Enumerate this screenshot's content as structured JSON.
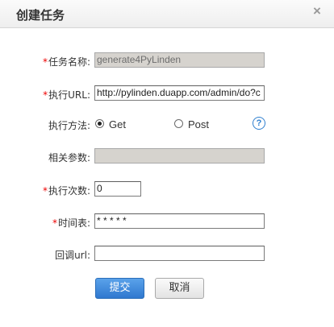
{
  "dialog": {
    "title": "创建任务",
    "close_glyph": "×"
  },
  "form": {
    "required_mark": "*",
    "task_name": {
      "label": "任务名称:",
      "value": "generate4PyLinden",
      "required": true
    },
    "exec_url": {
      "label": "执行URL:",
      "value": "http://pylinden.duapp.com/admin/do?c",
      "required": true
    },
    "method": {
      "label": "执行方法:",
      "options": [
        "Get",
        "Post"
      ],
      "selected": "Get",
      "help_glyph": "?"
    },
    "params": {
      "label": "相关参数:",
      "value": ""
    },
    "exec_count": {
      "label": "执行次数:",
      "value": "0",
      "required": true
    },
    "schedule": {
      "label": "时间表:",
      "value": "* * * * *",
      "required": true
    },
    "callback_url": {
      "label": "回调url:",
      "value": ""
    }
  },
  "buttons": {
    "submit": "提交",
    "cancel": "取消"
  },
  "colors": {
    "required": "#ee0000",
    "primary_button": "#2f78cf",
    "help_icon": "#2f7fcf",
    "disabled_input": "#d6d3ce"
  }
}
